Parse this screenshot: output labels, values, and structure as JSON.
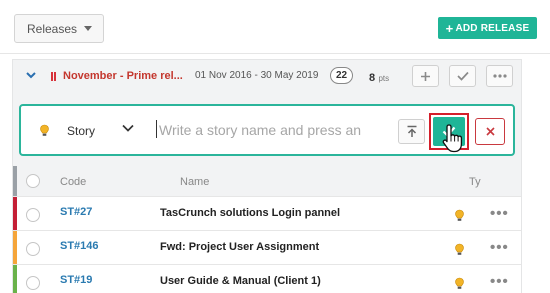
{
  "toolbar": {
    "releases_label": "Releases",
    "add_release_label": "ADD RELEASE"
  },
  "release": {
    "name": "November - Prime rel...",
    "date_range": "01 Nov 2016 - 30 May 2019",
    "story_count": "22",
    "points": "8",
    "points_unit": "pts"
  },
  "quick_add": {
    "type_label": "Story",
    "placeholder": "Write a story name and press an"
  },
  "table": {
    "columns": [
      "Code",
      "Name",
      "Ty"
    ],
    "rows": [
      {
        "code": "ST#27",
        "name": "TasCrunch solutions Login pannel",
        "strip_color": "#c41f36"
      },
      {
        "code": "ST#146",
        "name": "Fwd: Project User Assignment",
        "strip_color": "#f5a53a"
      },
      {
        "code": "ST#19",
        "name": "User Guide & Manual (Client 1)",
        "strip_color": "#6ab24a"
      }
    ]
  },
  "colors": {
    "accent": "#1fb597",
    "danger": "#d41f2b",
    "link": "#2a7ab0",
    "release_name": "#c4372e"
  },
  "icons": [
    "caret-down-icon",
    "plus-icon",
    "chevron-down-icon",
    "pause-icon",
    "more-icon",
    "check-icon",
    "lightbulb-icon",
    "move-to-top-icon",
    "close-icon",
    "hand-cursor-icon"
  ]
}
